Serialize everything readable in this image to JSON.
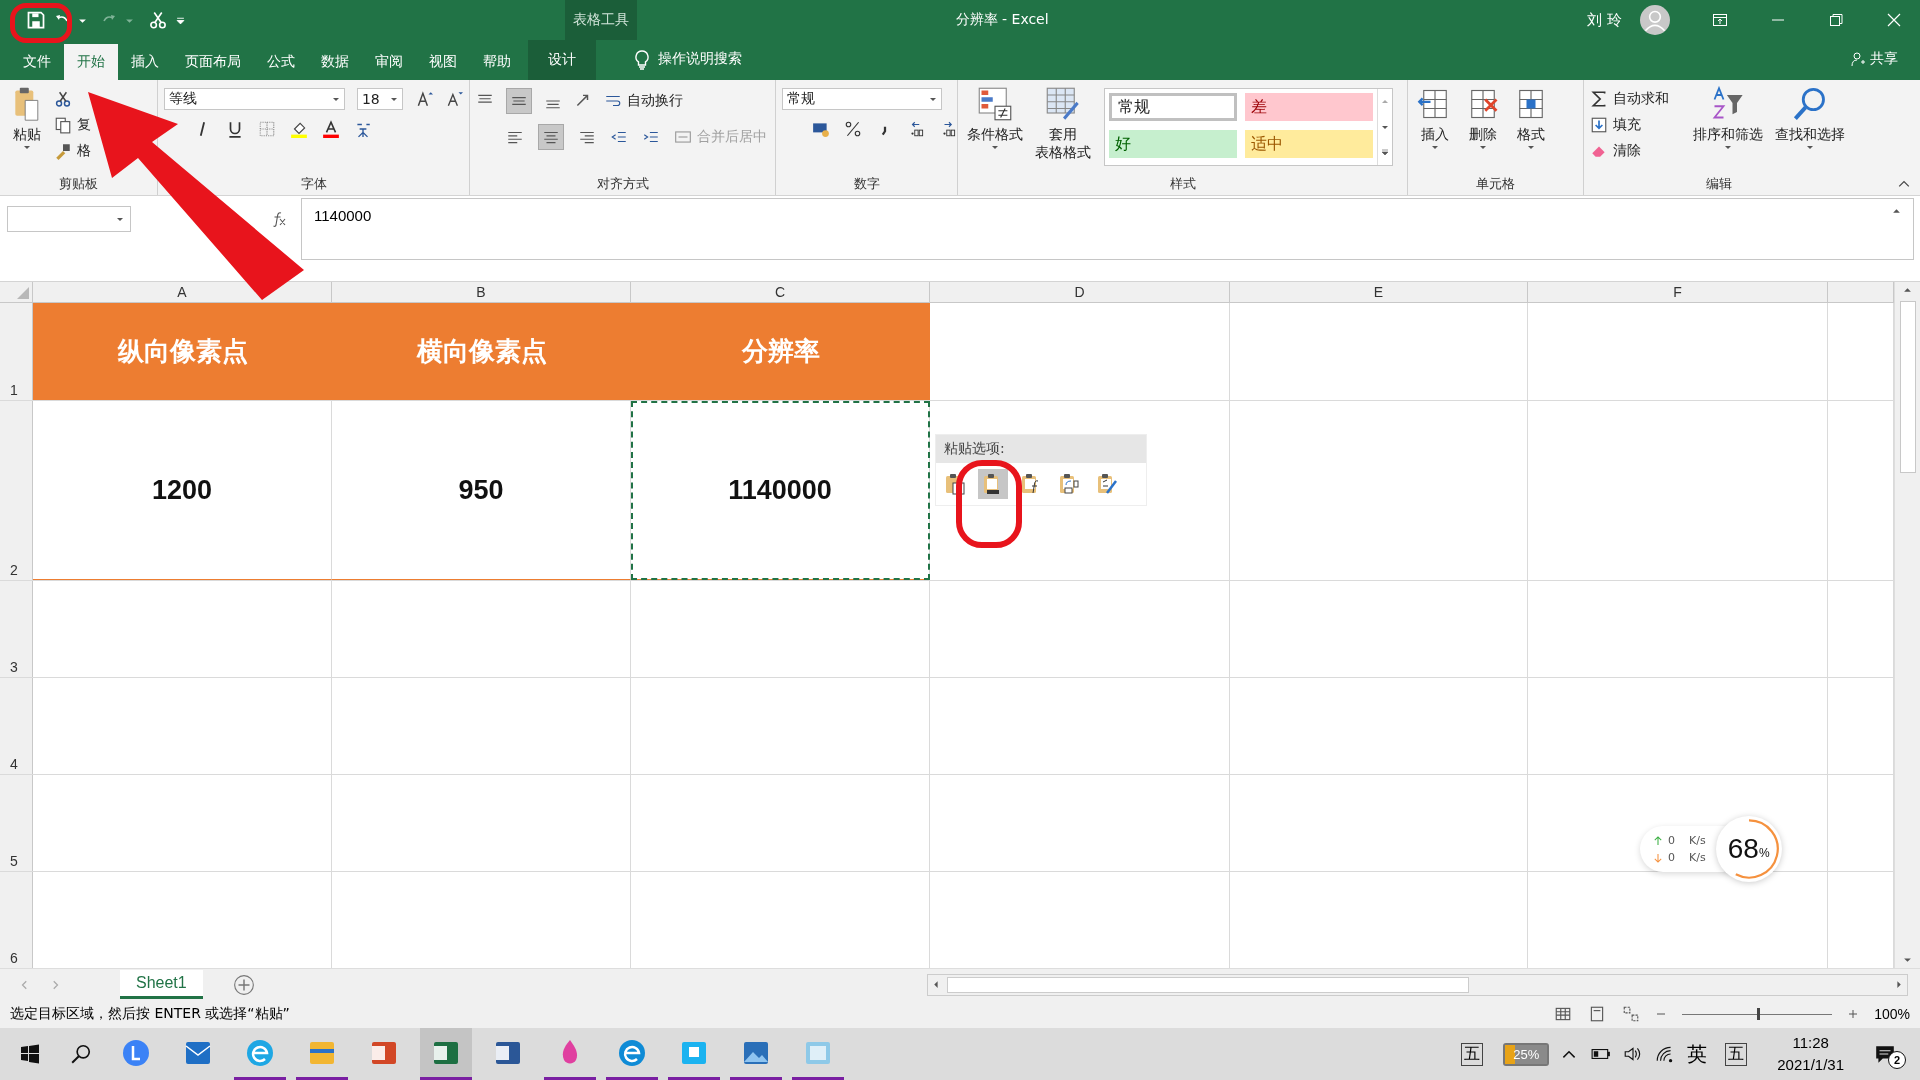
{
  "title_bar": {
    "context_group": "表格工具",
    "document_title": "分辨率 - Excel",
    "user_name": "刘 玲"
  },
  "ribbon_tabs": [
    {
      "label": "文件",
      "selected": false,
      "kind": "normal"
    },
    {
      "label": "开始",
      "selected": true,
      "kind": "normal"
    },
    {
      "label": "插入",
      "selected": false,
      "kind": "normal"
    },
    {
      "label": "页面布局",
      "selected": false,
      "kind": "normal"
    },
    {
      "label": "公式",
      "selected": false,
      "kind": "normal"
    },
    {
      "label": "数据",
      "selected": false,
      "kind": "normal"
    },
    {
      "label": "审阅",
      "selected": false,
      "kind": "normal"
    },
    {
      "label": "视图",
      "selected": false,
      "kind": "normal"
    },
    {
      "label": "帮助",
      "selected": false,
      "kind": "normal"
    },
    {
      "label": "设计",
      "selected": false,
      "kind": "contextual"
    }
  ],
  "tell_me": "操作说明搜索",
  "share": "共享",
  "ribbon": {
    "clipboard": {
      "paste": "粘贴",
      "copy": "复",
      "format_painter": "格",
      "label": "剪贴板"
    },
    "font": {
      "font_name": "等线",
      "font_size": "18",
      "label": "字体"
    },
    "alignment": {
      "wrap_text": "自动换行",
      "merge_center": {
        "label": "合并后居中",
        "disabled": true
      },
      "label": "对齐方式"
    },
    "number": {
      "format": "常规",
      "label": "数字"
    },
    "styles": {
      "conditional_formatting": "条件格式",
      "format_as_table": [
        "套用",
        "表格格式"
      ],
      "cell_styles": [
        {
          "label": "常规",
          "color": "#ffffff",
          "selected": true
        },
        {
          "label": "差",
          "color": "#ffc7ce",
          "selected": false
        },
        {
          "label": "好",
          "color": "#c6efce",
          "selected": false
        },
        {
          "label": "适中",
          "color": "#ffeb9c",
          "selected": false
        }
      ],
      "label": "样式"
    },
    "cells": {
      "buttons": [
        "插入",
        "删除",
        "格式"
      ],
      "label": "单元格"
    },
    "editing": {
      "autosum": "自动求和",
      "fill": "填充",
      "clear": "清除",
      "sort_filter": "排序和筛选",
      "find_select": "查找和选择",
      "label": "编辑"
    }
  },
  "formula_bar": {
    "formula": "1140000"
  },
  "columns": [
    "A",
    "B",
    "C",
    "D",
    "E",
    "F"
  ],
  "rows": [
    "1",
    "2",
    "3",
    "4",
    "5",
    "6"
  ],
  "table": {
    "header": [
      "纵向像素点",
      "横向像素点",
      "分辨率"
    ],
    "row": [
      "1200",
      "950",
      "1140000"
    ]
  },
  "paste_options": {
    "label": "粘贴选项:",
    "buttons": [
      {
        "kind": "paste",
        "selected": false
      },
      {
        "kind": "values",
        "selected": true
      },
      {
        "kind": "formulas",
        "selected": false
      },
      {
        "kind": "transpose",
        "selected": false
      },
      {
        "kind": "formatting",
        "selected": false
      }
    ]
  },
  "sheet_tabs": [
    {
      "label": "Sheet1",
      "selected": true
    }
  ],
  "status_bar": {
    "message": "选定目标区域，然后按 ENTER 或选择“粘贴”",
    "zoom_slider": {
      "level": 0.5
    },
    "zoom": "100%"
  },
  "net_widget": {
    "up": "0",
    "up_unit": "K/s",
    "down": "0",
    "down_unit": "K/s",
    "percent": "68",
    "percent_unit": "%"
  },
  "taskbar": {
    "apps": [
      {
        "kind": "l",
        "running": false
      },
      {
        "kind": "mail",
        "running": false
      },
      {
        "kind": "ie",
        "running": true
      },
      {
        "kind": "folder",
        "running": true
      },
      {
        "kind": "ppt",
        "running": false
      },
      {
        "kind": "excel",
        "running": true
      },
      {
        "kind": "word",
        "running": false
      },
      {
        "kind": "paint",
        "running": true
      },
      {
        "kind": "edge",
        "running": true
      },
      {
        "kind": "app",
        "running": true
      },
      {
        "kind": "photos",
        "running": true
      },
      {
        "kind": "notepad",
        "running": true
      }
    ],
    "ime_left": "五",
    "battery": "25%",
    "language": "英",
    "ime_right": "五",
    "time": "11:28",
    "date": "2021/1/31",
    "notifications": "2"
  }
}
